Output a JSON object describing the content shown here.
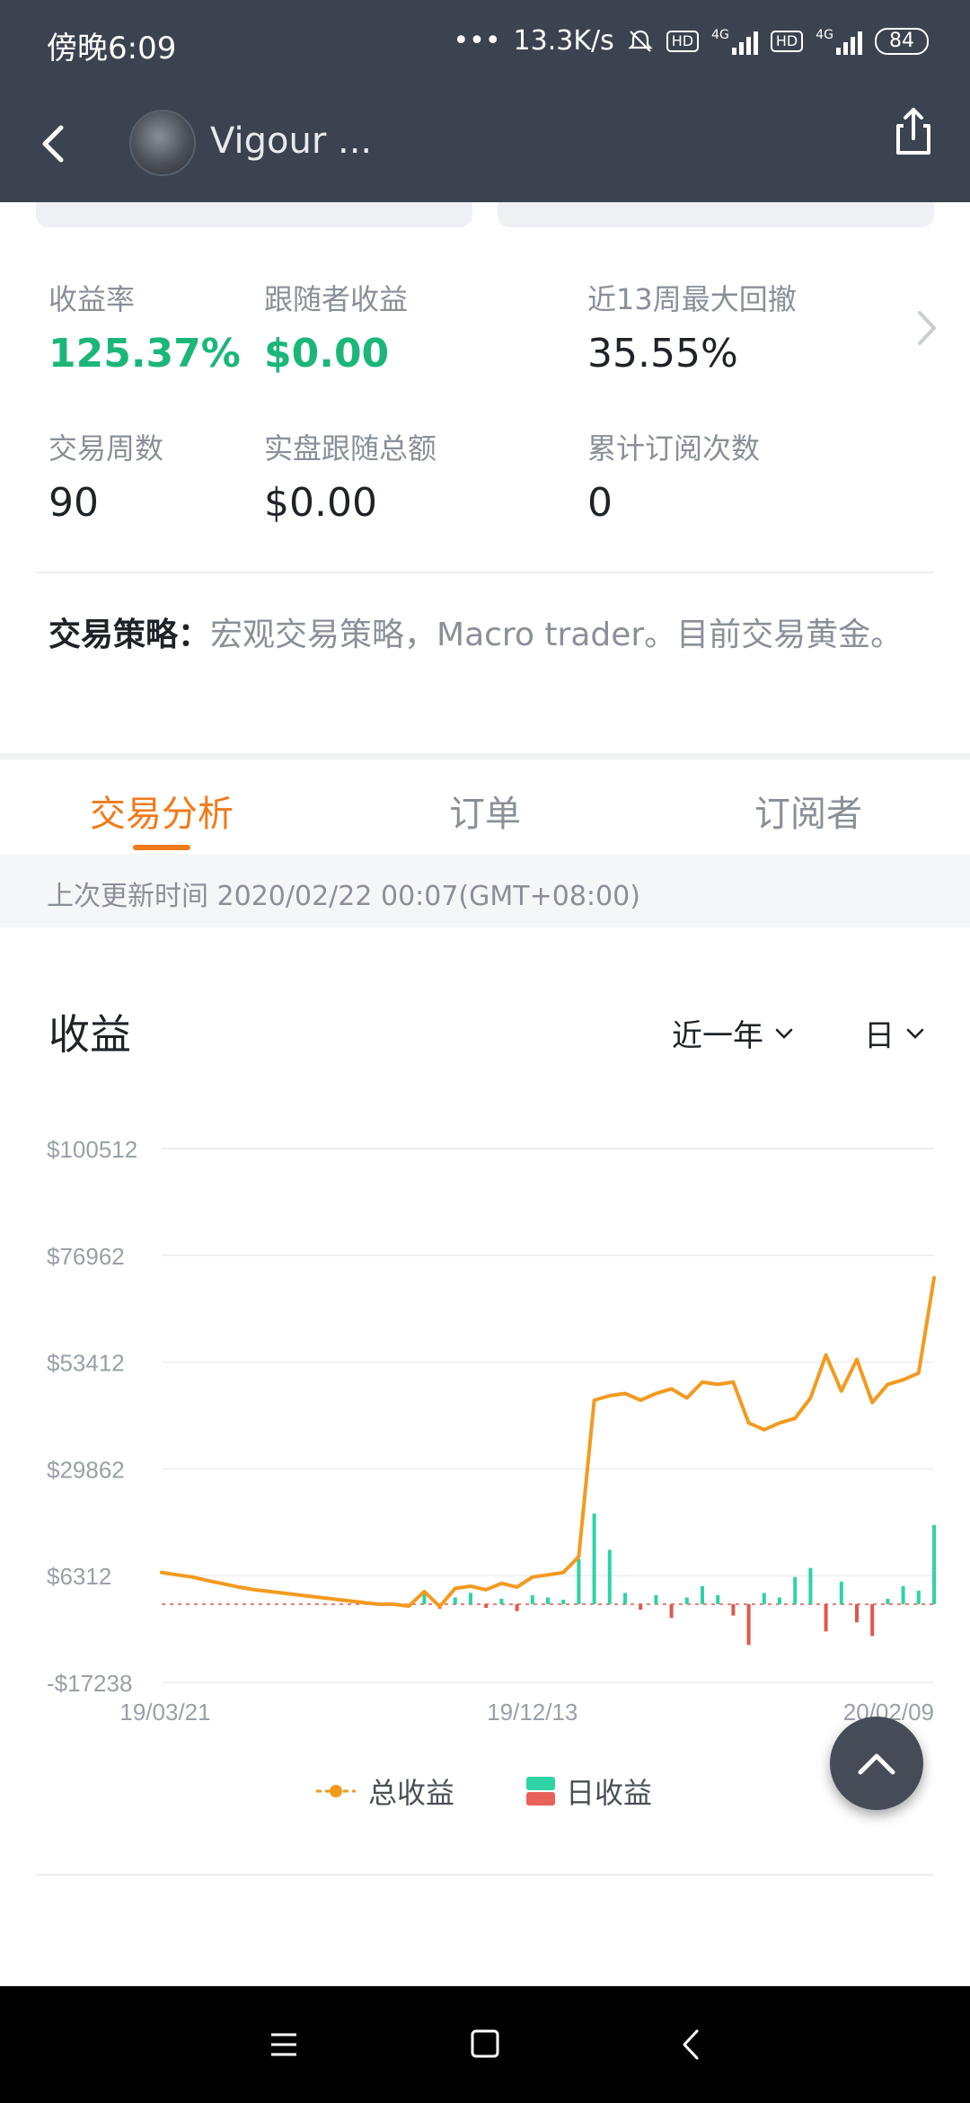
{
  "status_bar": {
    "time": "傍晚6:09",
    "speed": "13.3K/s",
    "battery": "84",
    "network_1": "4G",
    "network_2": "4G",
    "hd": "HD"
  },
  "header": {
    "trader_name": "Vigour ..."
  },
  "stats": [
    {
      "label": "收益率",
      "value": "125.37%"
    },
    {
      "label": "跟随者收益",
      "value": "$0.00"
    },
    {
      "label": "近13周最大回撤",
      "value": "35.55%"
    },
    {
      "label": "交易周数",
      "value": "90"
    },
    {
      "label": "实盘跟随总额",
      "value": "$0.00"
    },
    {
      "label": "累计订阅次数",
      "value": "0"
    }
  ],
  "strategy": {
    "label": "交易策略：",
    "text": "宏观交易策略，Macro trader。目前交易黄金。"
  },
  "tabs": [
    {
      "label": "交易分析"
    },
    {
      "label": "订单"
    },
    {
      "label": "订阅者"
    }
  ],
  "last_updated": "上次更新时间 2020/02/22 00:07(GMT+08:00)",
  "chart_section": {
    "title": "收益",
    "range_select": "近一年",
    "period_select": "日"
  },
  "colors": {
    "accent": "#f07a1a",
    "positive": "#1bb67a",
    "negative": "#e2574c",
    "header_bg": "#3b4350"
  },
  "chart_data": {
    "type": "line",
    "ylim": [
      -17238,
      100512
    ],
    "y_ticks": [
      "$100512",
      "$76962",
      "$53412",
      "$29862",
      "$6312",
      "-$17238"
    ],
    "y_tick_values": [
      100512,
      76962,
      53412,
      29862,
      6312,
      -17238
    ],
    "x_tick_labels": [
      "19/03/21",
      "19/12/13",
      "20/02/09"
    ],
    "grid": true,
    "legend_position": "bottom",
    "series": [
      {
        "name": "总收益",
        "type": "line",
        "color": "#f39a1f",
        "values": [
          7000,
          6500,
          6000,
          5200,
          4500,
          3800,
          3200,
          2800,
          2400,
          2000,
          1600,
          1200,
          800,
          400,
          0,
          0,
          -400,
          2800,
          -500,
          3500,
          4000,
          3200,
          4600,
          3800,
          6000,
          6500,
          7000,
          10500,
          45000,
          46000,
          46500,
          45000,
          46500,
          47500,
          45500,
          49000,
          48500,
          49000,
          40000,
          38500,
          40000,
          41000,
          45500,
          55000,
          47000,
          54000,
          44500,
          48500,
          49500,
          51000,
          72000
        ]
      },
      {
        "name": "日收益",
        "type": "bar",
        "values": [
          0,
          0,
          0,
          0,
          0,
          0,
          0,
          0,
          0,
          0,
          0,
          0,
          0,
          0,
          0,
          0,
          0,
          3000,
          -1000,
          1500,
          2500,
          -800,
          1200,
          -1500,
          2000,
          1500,
          1000,
          10000,
          20000,
          12000,
          2500,
          -1200,
          2000,
          -3000,
          1500,
          4000,
          2000,
          -2500,
          -9000,
          2500,
          1500,
          6000,
          8000,
          -6000,
          5000,
          -4000,
          -7000,
          1200,
          4000,
          3000,
          17500
        ]
      }
    ]
  }
}
